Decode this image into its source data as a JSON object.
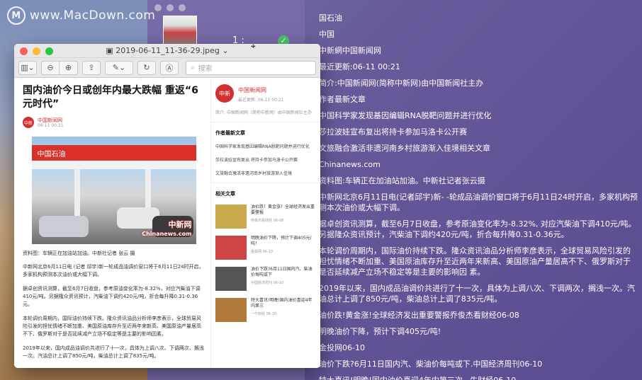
{
  "watermark": {
    "logo": "M",
    "text": "www.MacDown.com"
  },
  "back_window": {
    "page_indicator": "1 :"
  },
  "preview": {
    "title": "2019-06-11_11-36-29.jpeg",
    "search_placeholder": "搜索",
    "toolbar_icons": [
      "sidebar-icon",
      "zoom-out-icon",
      "zoom-in-icon",
      "share-icon",
      "markup-icon",
      "rotate-icon",
      "annotate-icon"
    ]
  },
  "article": {
    "title": "国内油价今日或创年内最大跌幅 重返“6元时代”",
    "source": "中国新闻网",
    "date": "06-11 00:21",
    "photo_canopy": "中国石油",
    "photo_stamp": "中新网\nChinanews.com",
    "caption": "资料图：车辆正在加油站加油。中新社记者 张云 摄",
    "paragraphs": [
      "中新网北京6月11日电 (记者 邱宇)新一轮成品油调价窗口将于6月11日24时开启，多家机构预测本次油价或大幅下调。",
      "据卓创资讯测算，截至6月7日收盘，参考原油变化率为-8.32%，对应汽柴油下调410元/吨。另据隆众资讯预计，汽柴油下调约420元/吨，折合每升降0.31-0.36元。",
      "本轮调价周期内，国际油价持续下跌。隆众资讯油品分析师李彦表示，全球贸易风险引发的担忧情绪不断加重、美国原油库存升至近两年来新高、美国原油产量居高不下、俄罗斯对于是否延续减产立场不稳定等是主要的影响因素。",
      "2019年以来，国内成品油调价共进行了十一次，具体为上调八次、下调两次、搁浅一次。汽油总计上调了850元/吨，柴油总计上调了835元/吨。"
    ]
  },
  "side": {
    "source": "中国新闻网",
    "date": "最近更新: 06-11 00:21",
    "brief": "简介: 中国新闻网（简称中新网）由中国新闻社主办",
    "author_section": "作者最新文章",
    "author_items": [
      "中国科学家发现基因编辑RNA脱靶问题并进行优化",
      "莎拉波娃宣布复出 将持卡参加马洛卡公开赛",
      "文旅融合激活非遗河南乡村旅游渐入佳境"
    ],
    "related_section": "相关文章",
    "related": [
      {
        "title": "油价跌！黄金涨！全球经济发出重要警报",
        "src": "乔俊杰看财经 06-08",
        "img": "#c9a94b"
      },
      {
        "title": "明晚油价下降，预计下调405元/吨！",
        "src": "金投网 06-10",
        "img": "#cc4444"
      },
      {
        "title": "油价下跌?6月11日国内汽、柴油价每吨或下",
        "src": "中国经济周刊 06-10",
        "img": "#555555"
      },
      {
        "title": "特大喜讯!明晚!国内油价喜迎4年内第三",
        "src": "一牛财经 06-10",
        "img": "#b07a3a"
      }
    ]
  },
  "ocr_lines": [
    "国石油",
    "中国",
    "中新網中国新闻网",
    "最近更新:06-11 00:21",
    "简介:中国新闻网(简称中新网)由中国新闻社主办",
    "作者最新文章",
    "中国科学家发现基因编辑RNA脱靶问题并进行优化",
    "莎拉波娃宣布复出将持卡参加马洛卡公开赛",
    "文旅融合激活非遗河南乡村旅游渐入佳境相关文章",
    "Chinanews.com",
    "资料图:车辆正在加油站加油。中新社记者张云摄",
    "中新网北京6月11日电(记者邱宇)新- -轮成品油调价窗口将于6月11日24时开启，多家机构预测本次油价或大幅下调。",
    "据卓创资讯测算，截至6月7日收盘，参考原油变化率为-8.32%, 对应汽柴油下调410元/吨。另据隆众资讯预计，汽柴油下调约420元/吨，折合每升降0.31-0.36元。",
    "本轮调价周期内，国际油价持续下跌。隆众资讯油品分析师李彦表示，全球贸易风险引发的担忧情绪不断加重、美国原油库存升至近两年来新高、美国原油产量居高不下、俄罗斯对于是否延续减产立场不稳定等是主要的影响因 素。",
    "2019年以来，国内成品油调价共进行了十一次，具体为上调八次、下调两次，搁浅一次。汽油总计上调了850元/吨，柴油总计上调了835元/吨。",
    "油价跌!黄金涨!全球经济发出重要警报乔俊杰看财经06-08",
    "明晚油价下降，预计下调405元/吨!",
    "金投网06-10",
    "油价下跌?6月11日国内汽、柴油价每吨或下.中国经济周刊06-10",
    "特大喜讯!明晚!国内油价喜迎4年内第三次...牛财经06-10"
  ]
}
